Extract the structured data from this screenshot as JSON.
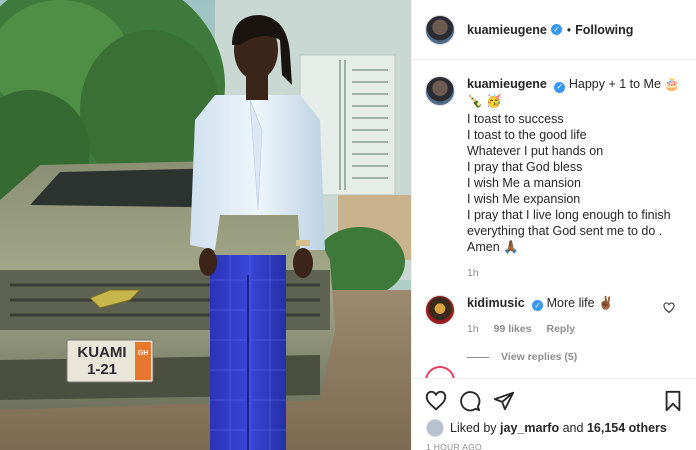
{
  "post": {
    "username": "kuamieugene",
    "follow_status": "Following",
    "dot": "•",
    "verified_mark": "✓",
    "photo": {
      "plate_line1": "KUAMI",
      "plate_line2": "1-21",
      "plate_tag": "GH"
    }
  },
  "caption": {
    "username": "kuamieugene",
    "first_line": "Happy + 1 to Me 🎂",
    "emoji_line": "🍾 🥳",
    "lines": [
      "I toast to success",
      "I toast to the good life",
      "Whatever I put hands on",
      "I pray that God bless",
      "I wish Me a mansion",
      "I wish Me expansion",
      "I pray that I live long enough to finish everything that God sent me to do .",
      "Amen 🙏🏾"
    ],
    "time": "1h"
  },
  "comment": {
    "username": "kidimusic",
    "text": "More life ✌🏾",
    "time": "1h",
    "likes": "99 likes",
    "reply": "Reply",
    "view_replies": "View replies (5)"
  },
  "likes": {
    "prefix": "Liked by",
    "user": "jay_marfo",
    "middle": "and",
    "count": "16,154 others"
  },
  "time_ago": "1 HOUR AGO",
  "icons": [
    "heart-icon",
    "comment-icon",
    "share-icon",
    "bookmark-icon"
  ],
  "colors": {
    "verified": "#3897f0",
    "muted": "#8e8e8e",
    "text": "#262626"
  }
}
